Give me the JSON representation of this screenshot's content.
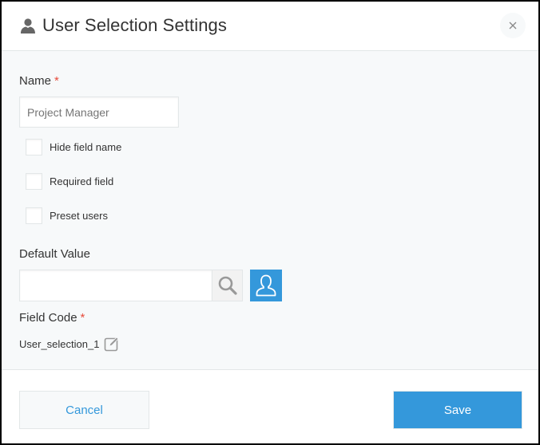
{
  "dialog": {
    "title": "User Selection Settings",
    "title_icon": "user-icon",
    "close_icon": "close-icon"
  },
  "form": {
    "name": {
      "label": "Name",
      "required_mark": "*",
      "placeholder": "Project Manager",
      "value": ""
    },
    "checkboxes": [
      {
        "label": "Hide field name",
        "checked": false
      },
      {
        "label": "Required field",
        "checked": false
      },
      {
        "label": "Preset users",
        "checked": false
      }
    ],
    "default_value": {
      "label": "Default Value",
      "value": "",
      "search_icon": "search-icon",
      "user_picker_icon": "user-icon"
    },
    "field_code": {
      "label": "Field Code",
      "required_mark": "*",
      "value": "User_selection_1",
      "edit_icon": "edit-icon"
    }
  },
  "footer": {
    "cancel_label": "Cancel",
    "save_label": "Save"
  },
  "colors": {
    "accent": "#3498db",
    "required": "#e74c3c",
    "body_bg": "#f7f9fa",
    "border": "#e3e7e8"
  }
}
